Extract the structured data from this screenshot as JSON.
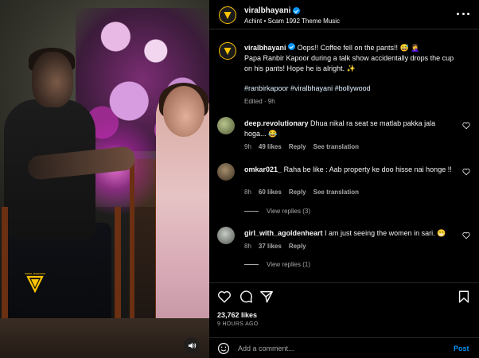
{
  "post": {
    "username": "viralbhayani",
    "audio_line": "Achint • Scam 1992 Theme Music"
  },
  "media": {
    "watermark_text": "VIRAL BHAYANI"
  },
  "caption": {
    "username": "viralbhayani",
    "line1": "Oops!! Coffee fell on the pants!! 😅 🤦‍♀️",
    "line2": "Papa Ranbir Kapoor during a talk show accidentally drops the cup on his pants! Hope he is alright. ✨",
    "hashtags": "#ranbirkapoor #viralbhayani #bollywood",
    "edited": "Edited · 9h"
  },
  "comments": [
    {
      "username": "deep.revolutionary",
      "text": "Dhua nikal ra seat se matlab pakka jala hoga... 😂",
      "time": "9h",
      "likes": "49 likes",
      "reply": "Reply",
      "see_translation": "See translation",
      "avatar_color": "#7a8a5a"
    },
    {
      "username": "omkar021_",
      "text": "Raha be like : Aab property ke doo hisse nai honge !!",
      "time": "8h",
      "likes": "60 likes",
      "reply": "Reply",
      "see_translation": "See translation",
      "view_replies": "View replies (3)",
      "avatar_color": "#6b5a44"
    },
    {
      "username": "girl_with_agoldenheart",
      "text": "I am just seeing the women in sari. 😁",
      "time": "8h",
      "likes": "37 likes",
      "reply": "Reply",
      "view_replies": "View replies (1)",
      "avatar_color": "#8a8f88"
    }
  ],
  "stats": {
    "likes": "23,762 likes",
    "time_ago": "9 HOURS AGO"
  },
  "composer": {
    "placeholder": "Add a comment...",
    "post_label": "Post"
  },
  "colors": {
    "accent": "#0095f6",
    "brand": "#ffc400",
    "background": "#000000",
    "muted": "#a8a8a8"
  }
}
